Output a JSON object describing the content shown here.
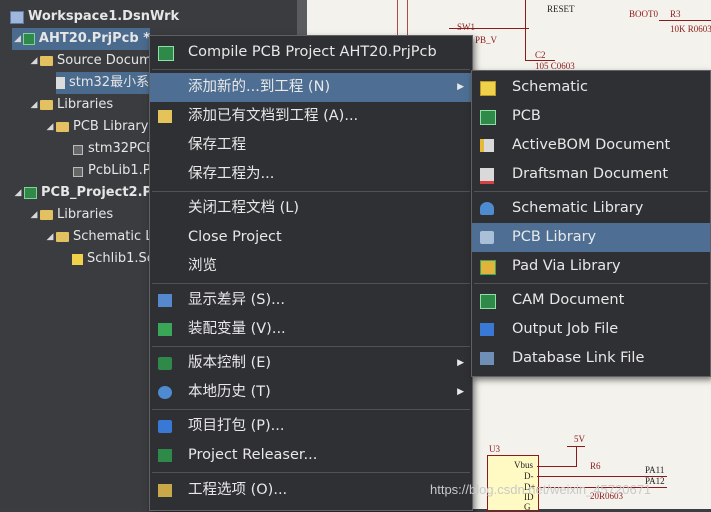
{
  "tree": {
    "workspace": "Workspace1.DsnWrk",
    "project1": "AHT20.PrjPcb *",
    "source_docs": "Source Docum",
    "schdoc": "stm32最小系",
    "libraries": "Libraries",
    "pcb_library": "PCB Library",
    "pcblib_a": "stm32PCB",
    "pcblib_b": "PcbLib1.P",
    "project2": "PCB_Project2.P",
    "libraries2": "Libraries",
    "sch_library": "Schematic Li",
    "schlib1": "Schlib1.Sc"
  },
  "schematic": {
    "sw1": "SW1",
    "pb_v": "PB_V",
    "reset": "RESET",
    "c2": "C2",
    "c2_val": "105 C0603",
    "boot0": "BOOT0",
    "r3": "R3",
    "r3_val": "10K R0603",
    "u3": "U3",
    "vbus": "Vbus",
    "dminus": "D-",
    "dplus": "D+",
    "id": "ID",
    "gnd": "G",
    "v5": "5V",
    "r6": "R6",
    "r_val": "20R0603",
    "pa11": "PA11",
    "pa12": "PA12"
  },
  "context_menu": {
    "items": [
      {
        "label": "Compile PCB Project AHT20.PrjPcb",
        "icon": "compile-icon"
      },
      {
        "label": "添加新的...到工程 (N)",
        "icon": "none"
      },
      {
        "label": "添加已有文档到工程 (A)...",
        "icon": "add-existing-icon"
      },
      {
        "label": "保存工程",
        "icon": "none"
      },
      {
        "label": "保存工程为...",
        "icon": "none"
      },
      {
        "label": "关闭工程文档 (L)",
        "icon": "none"
      },
      {
        "label": "Close Project",
        "icon": "none"
      },
      {
        "label": "浏览",
        "icon": "none"
      },
      {
        "label": "显示差异 (S)...",
        "icon": "diff-icon"
      },
      {
        "label": "装配变量 (V)...",
        "icon": "variant-icon"
      },
      {
        "label": "版本控制 (E)",
        "icon": "version-control-icon"
      },
      {
        "label": "本地历史 (T)",
        "icon": "history-icon"
      },
      {
        "label": "项目打包 (P)...",
        "icon": "package-icon"
      },
      {
        "label": "Project Releaser...",
        "icon": "releaser-icon"
      },
      {
        "label": "工程选项 (O)...",
        "icon": "options-icon"
      }
    ]
  },
  "submenu": {
    "items": [
      {
        "label": "Schematic",
        "icon": "schematic-icon"
      },
      {
        "label": "PCB",
        "icon": "pcb-icon"
      },
      {
        "label": "ActiveBOM Document",
        "icon": "activebom-icon"
      },
      {
        "label": "Draftsman Document",
        "icon": "draftsman-icon"
      },
      {
        "label": "Schematic Library",
        "icon": "schematic-library-icon"
      },
      {
        "label": "PCB Library",
        "icon": "pcb-library-icon"
      },
      {
        "label": "Pad Via Library",
        "icon": "pad-via-icon"
      },
      {
        "label": "CAM Document",
        "icon": "cam-icon"
      },
      {
        "label": "Output Job File",
        "icon": "output-job-icon"
      },
      {
        "label": "Database Link File",
        "icon": "database-link-icon"
      }
    ]
  },
  "watermark": "https://blog.csdn.net/weixin_45720671"
}
